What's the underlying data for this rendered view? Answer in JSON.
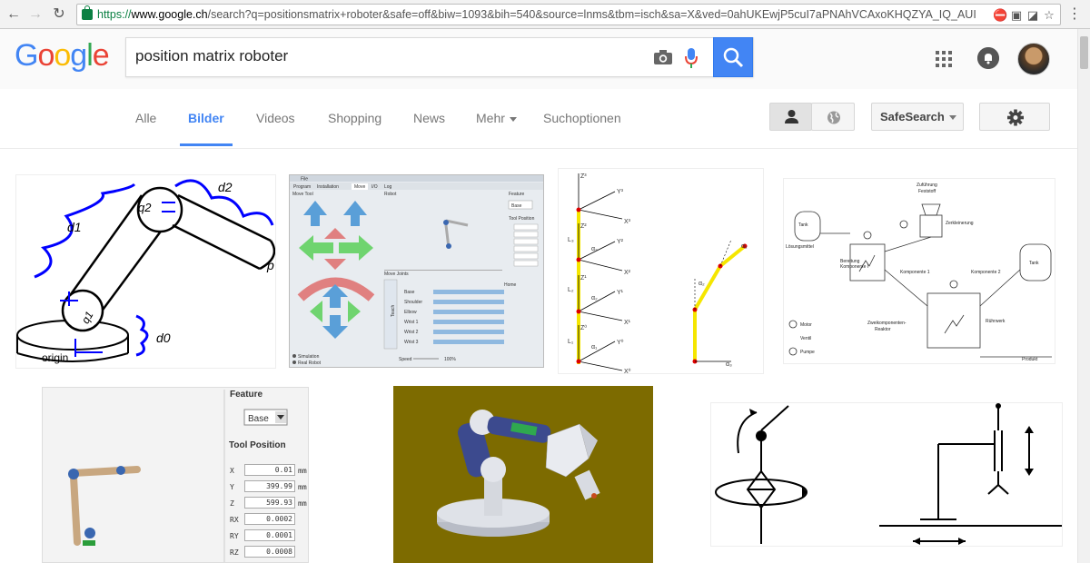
{
  "browser": {
    "url_proto": "https://",
    "url_host": "www.google.ch",
    "url_rest": "/search?q=positionsmatrix+roboter&safe=off&biw=1093&bih=540&source=lnms&tbm=isch&sa=X&ved=0ahUKEwjP5cuI7aPNAhVCAxoKHQZYA_IQ_AUI"
  },
  "logo": [
    "G",
    "o",
    "o",
    "g",
    "l",
    "e"
  ],
  "search": {
    "query": "position matrix roboter"
  },
  "tabs": [
    {
      "label": "Alle"
    },
    {
      "label": "Bilder"
    },
    {
      "label": "Videos"
    },
    {
      "label": "Shopping"
    },
    {
      "label": "News"
    },
    {
      "label": "Mehr"
    },
    {
      "label": "Suchoptionen"
    }
  ],
  "toolbar": {
    "safesearch_label": "SafeSearch"
  },
  "results": {
    "r1": {
      "labels": [
        "q2",
        "d2",
        "d1",
        "p",
        "q1",
        "d0",
        "origin"
      ]
    },
    "r2": {
      "title": "File",
      "tabs": [
        "Program",
        "Installation",
        "Move",
        "I/O",
        "Log"
      ],
      "section_move": "Move Tool",
      "section_robot": "Robot",
      "feature": "Feature",
      "base": "Base",
      "tool_pos": "Tool Position",
      "move_joints": "Move Joints",
      "joints": [
        "Base",
        "Shoulder",
        "Elbow",
        "Wrist 1",
        "Wrist 2",
        "Wrist 3"
      ],
      "home": "Home",
      "teach": "Teach",
      "sim": "Simulation",
      "real": "Real Robot",
      "speed": "Speed",
      "speed_val": "100%"
    },
    "r3": {
      "labels": [
        "Z³",
        "Y³",
        "X³",
        "Z²",
        "Y²",
        "X²",
        "Z¹",
        "Y¹",
        "X¹",
        "Z⁰",
        "Y⁰",
        "X⁰",
        "L₃",
        "L₂",
        "L₁",
        "α₃",
        "α₂",
        "α₁",
        "α₁",
        "α₂",
        "α₃"
      ]
    },
    "r4": {
      "zufuhr": "Zuführung",
      "feststoff": "Feststoff",
      "zerkleinerung": "Zerkleinerung",
      "tank": "Tank",
      "loesungsmittel": "Lösungsmittel",
      "bereitung": "Bereitung",
      "komp1_label": "Komponente I",
      "komp1": "Komponente 1",
      "komp2": "Komponente 2",
      "tank2": "Tank",
      "motor": "Motor",
      "ventil": "Ventil",
      "pumpe": "Pumpe",
      "zwei": "Zweikomponenten-",
      "reaktor": "Reaktor",
      "ruehr": "Rührwerk",
      "produkt": "Produkt"
    },
    "r5": {
      "feature": "Feature",
      "base": "Base",
      "tool_position": "Tool Position",
      "fields": [
        {
          "label": "X",
          "value": "0.01",
          "unit": "mm"
        },
        {
          "label": "Y",
          "value": "399.99",
          "unit": "mm"
        },
        {
          "label": "Z",
          "value": "599.93",
          "unit": "mm"
        },
        {
          "label": "RX",
          "value": "0.0002",
          "unit": ""
        },
        {
          "label": "RY",
          "value": "0.0001",
          "unit": ""
        },
        {
          "label": "RZ",
          "value": "0.0008",
          "unit": ""
        }
      ]
    }
  },
  "colors": {
    "accent": "#4285f4",
    "yellow_arm": "#f5e600",
    "olive_bg": "#7d6b00"
  }
}
